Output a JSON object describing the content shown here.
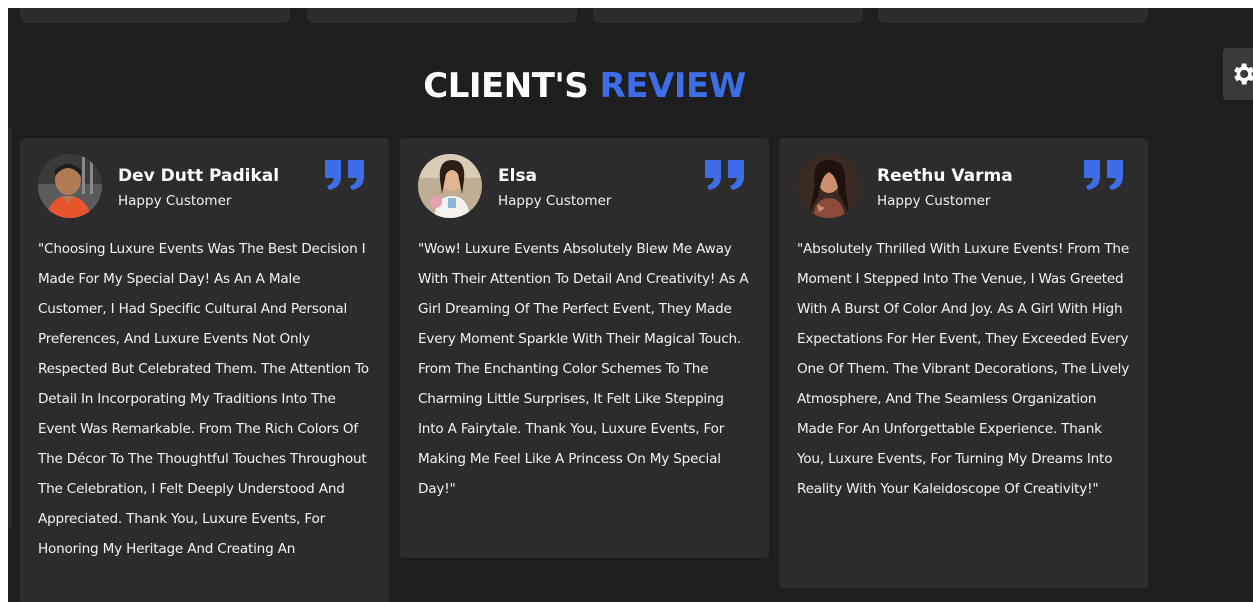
{
  "section": {
    "title_main": "CLIENT'S",
    "title_accent": "REVIEW"
  },
  "colors": {
    "background": "#1e1e1e",
    "card": "#2c2c2c",
    "accent": "#3d6ee8",
    "text": "#ffffff"
  },
  "icons": {
    "settings": "gear-icon",
    "quote": "quote-icon"
  },
  "reviews": [
    {
      "name": "Dev Dutt Padikal",
      "role": "Happy Customer",
      "text": "\"Choosing Luxure Events Was The Best Decision I Made For My Special Day! As An A Male Customer, I Had Specific Cultural And Personal Preferences, And Luxure Events Not Only Respected But Celebrated Them. The Attention To Detail In Incorporating My Traditions Into The Event Was Remarkable. From The Rich Colors Of The Décor To The Thoughtful Touches Throughout The Celebration, I Felt Deeply Understood And Appreciated. Thank You, Luxure Events, For Honoring My Heritage And Creating An"
    },
    {
      "name": "Elsa",
      "role": "Happy Customer",
      "text": "\"Wow! Luxure Events Absolutely Blew Me Away With Their Attention To Detail And Creativity! As A Girl Dreaming Of The Perfect Event, They Made Every Moment Sparkle With Their Magical Touch. From The Enchanting Color Schemes To The Charming Little Surprises, It Felt Like Stepping Into A Fairytale. Thank You, Luxure Events, For Making Me Feel Like A Princess On My Special Day!\""
    },
    {
      "name": "Reethu Varma",
      "role": "Happy Customer",
      "text": "\"Absolutely Thrilled With Luxure Events! From The Moment I Stepped Into The Venue, I Was Greeted With A Burst Of Color And Joy. As A Girl With High Expectations For Her Event, They Exceeded Every One Of Them. The Vibrant Decorations, The Lively Atmosphere, And The Seamless Organization Made For An Unforgettable Experience. Thank You, Luxure Events, For Turning My Dreams Into Reality With Your Kaleidoscope Of Creativity!\""
    }
  ]
}
